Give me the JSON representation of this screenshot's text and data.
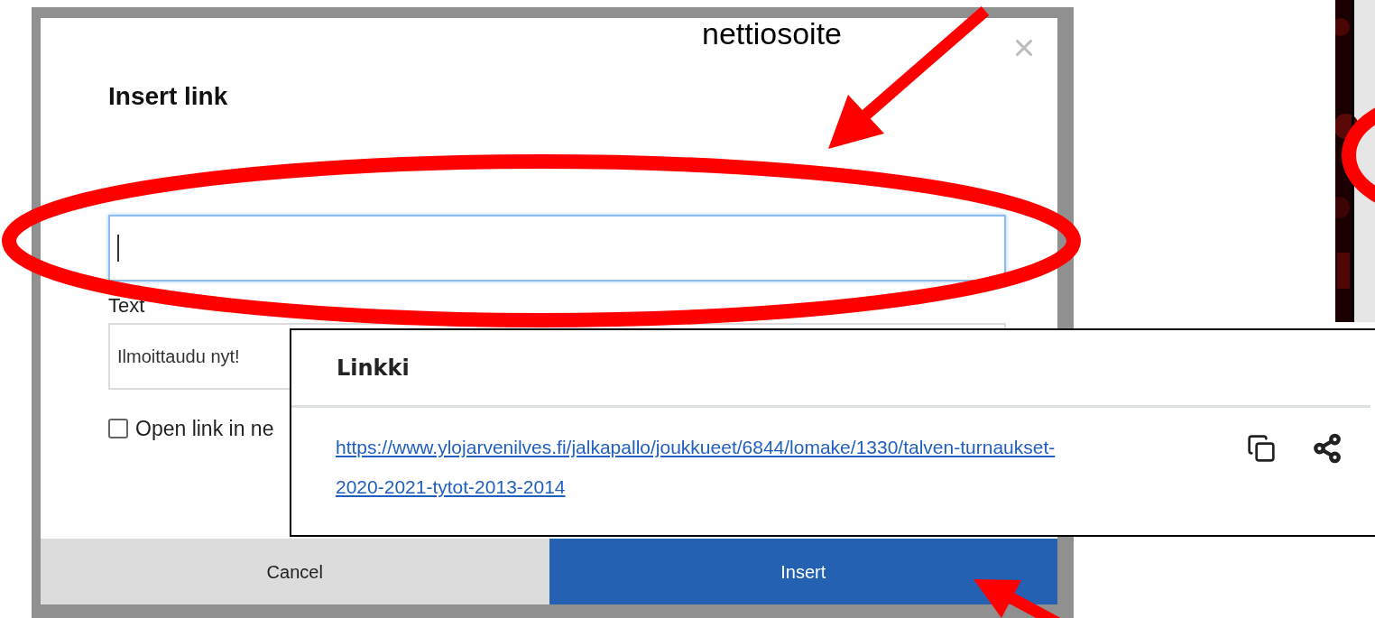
{
  "dialog": {
    "title": "Insert link",
    "fields": [
      {
        "focused": true
      },
      {
        "label": "Text",
        "value": "Ilmoittaudu nyt!",
        "focused": false
      }
    ],
    "checkbox": {
      "label": "Open link in ne",
      "checked": false
    },
    "buttons": [
      {
        "label": "Cancel",
        "kind": "secondary"
      },
      {
        "label": "Insert",
        "kind": "primary"
      }
    ]
  },
  "link_popup": {
    "title": "Linkki",
    "link_lines": [
      "https://www.ylojarvenilves.fi/jalkapallo/joukkueet/6844/lomake/1330/talven-turnaukset-",
      "2020-2021-tytot-2013-2014"
    ]
  },
  "annotation": {
    "text": "nettiosoite"
  }
}
